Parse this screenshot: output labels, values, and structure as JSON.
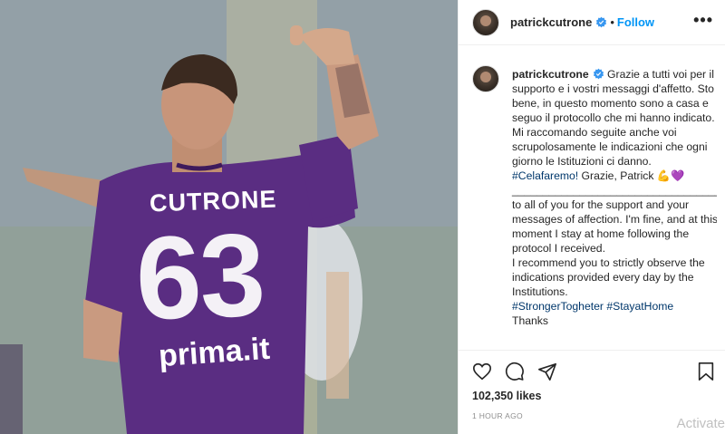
{
  "post": {
    "username": "patrickcutrone",
    "follow_label": "Follow",
    "separator": "•",
    "more_label": "•••",
    "jersey_name": "CUTRONE",
    "jersey_number": "63",
    "sponsor": "prima.it",
    "caption_username": "patrickcutrone",
    "caption_it": " Grazie a tutti voi per il supporto e i vostri messaggi d'affetto. Sto bene, in questo momento sono a casa e seguo il protocollo che mi hanno indicato. Mi raccomando seguite anche voi scrupolosamente le indicazioni che ogni giorno le Istituzioni ci danno.\n",
    "hashtag_it": "#Celafaremo!",
    "caption_it_end": " Grazie, Patrick 💪💜\n",
    "divider": "_________________________________________",
    "caption_en": "Thanks to all of you for the support and your messages of affection. I'm fine, and at this moment I stay at home following the protocol I received.\nI recommend you to strictly observe the indications provided every day by the Institutions.\n",
    "hashtags_en": "#StrongerTogheter #StayatHome",
    "caption_en_tail": "\nThanks",
    "likes": "102,350 likes",
    "time": "1 HOUR AGO"
  },
  "overlay": {
    "watermark": "Activate"
  },
  "colors": {
    "accent": "#0095f6",
    "jersey": "#5a2d82",
    "verified": "#3897f0"
  },
  "icons": [
    "verified-badge-icon",
    "more-icon",
    "heart-icon",
    "comment-icon",
    "share-icon",
    "save-icon"
  ]
}
